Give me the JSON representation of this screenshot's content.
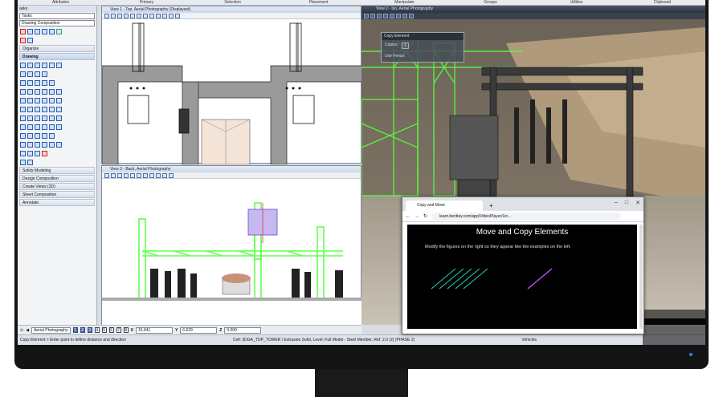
{
  "ribbon": {
    "tabs": [
      "Attributes",
      "Primary",
      "Selection",
      "Placement",
      "Manipulate",
      "Groups",
      "Utilities",
      "Clipboard"
    ]
  },
  "tasks": {
    "header": "asks",
    "combo_label": "Tasks",
    "active_item": "Drawing Composition",
    "sections": {
      "organize": "Organize",
      "drawing": "Drawing",
      "solids": "Solids Modeling",
      "design": "Design Composition",
      "create_views": "Create Views (3D)",
      "sheet": "Sheet Composition",
      "annotate": "Annotate"
    }
  },
  "views": {
    "top": {
      "title": "View 1 - Top, Aerial Photography (Displayset)"
    },
    "back": {
      "title": "View 3 - Back, Aerial Photography"
    },
    "render": {
      "title": "View 2 - Iso, Aerial Photography"
    }
  },
  "copy_dialog": {
    "title": "Copy Element",
    "copies_label": "Copies:",
    "copies_value": "1",
    "use_fence_label": "Use Fence:"
  },
  "status": {
    "view_name": "Aerial Photography",
    "view_numbers": [
      "1",
      "2",
      "3",
      "4",
      "5",
      "6",
      "7",
      "8"
    ],
    "x_label": "X",
    "x_value": "15.941",
    "y_label": "Y",
    "y_value": "6.629",
    "z_label": "Z",
    "z_value": "0.000"
  },
  "prompt": {
    "left": "Copy Element > Enter point to define distance and direction",
    "right": "Cell: 3DGA_TOP_TOWER \\ Extrusion Solid, Level: Full Model - Steel Member, Ref: 2.0 (2) (PHASE 2)",
    "vehicles": "Vehicles"
  },
  "browser": {
    "tab_title": "Copy and Move",
    "url": "learn.bentley.com/app/VideoPlayer/Lin...",
    "new_tab": "+",
    "slide_title": "Move and Copy Elements",
    "slide_subtitle": "Modify the figures on the right so they appear like the examples on the left."
  },
  "colors": {
    "accent": "#2f82d8",
    "steel": "#7cff60",
    "roof": "#a58f74"
  }
}
